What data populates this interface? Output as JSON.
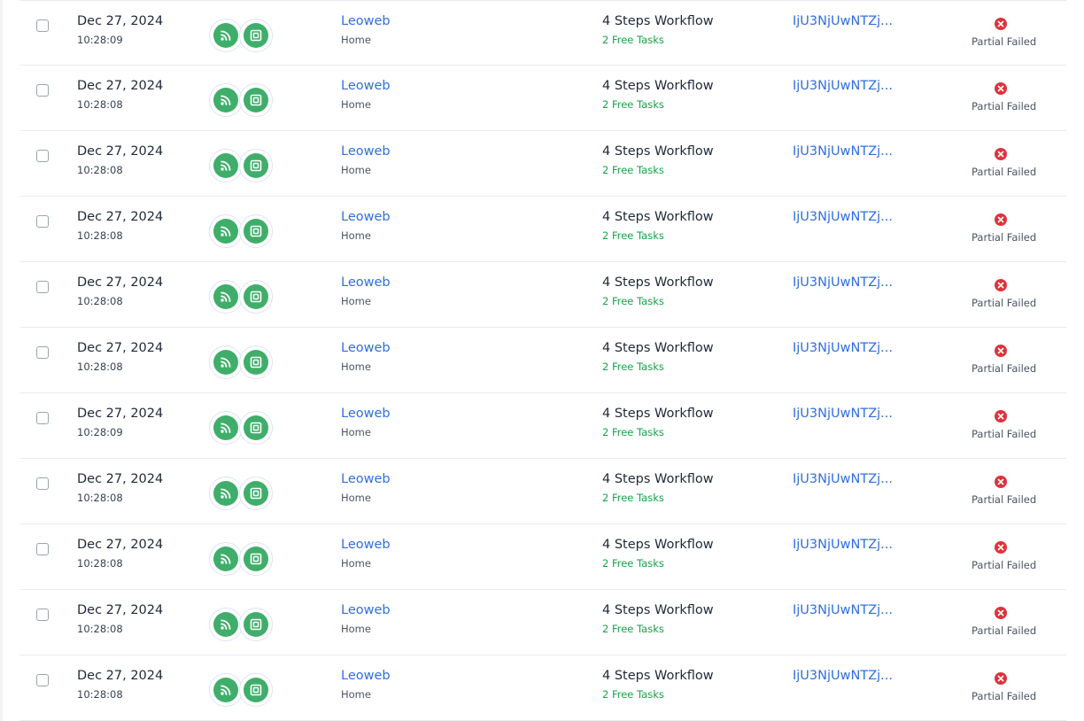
{
  "colors": {
    "link": "#2f6fe0",
    "app_green": "#3fae6a",
    "free_tasks_green": "#16a34a",
    "failed_red": "#e0323a"
  },
  "icons": {
    "app_1": "rss-feed-icon",
    "app_2": "scan-frame-icon",
    "status": "x-circle-icon"
  },
  "rows": [
    {
      "date": "Dec 27, 2024",
      "time": "10:28:09",
      "connection": "Leoweb",
      "connection_sub": "Home",
      "workflow": "4 Steps Workflow",
      "tasks": "2 Free Tasks",
      "task_id": "IjU3NjUwNTZj...",
      "status": "Partial Failed"
    },
    {
      "date": "Dec 27, 2024",
      "time": "10:28:08",
      "connection": "Leoweb",
      "connection_sub": "Home",
      "workflow": "4 Steps Workflow",
      "tasks": "2 Free Tasks",
      "task_id": "IjU3NjUwNTZj...",
      "status": "Partial Failed"
    },
    {
      "date": "Dec 27, 2024",
      "time": "10:28:08",
      "connection": "Leoweb",
      "connection_sub": "Home",
      "workflow": "4 Steps Workflow",
      "tasks": "2 Free Tasks",
      "task_id": "IjU3NjUwNTZj...",
      "status": "Partial Failed"
    },
    {
      "date": "Dec 27, 2024",
      "time": "10:28:08",
      "connection": "Leoweb",
      "connection_sub": "Home",
      "workflow": "4 Steps Workflow",
      "tasks": "2 Free Tasks",
      "task_id": "IjU3NjUwNTZj...",
      "status": "Partial Failed"
    },
    {
      "date": "Dec 27, 2024",
      "time": "10:28:08",
      "connection": "Leoweb",
      "connection_sub": "Home",
      "workflow": "4 Steps Workflow",
      "tasks": "2 Free Tasks",
      "task_id": "IjU3NjUwNTZj...",
      "status": "Partial Failed"
    },
    {
      "date": "Dec 27, 2024",
      "time": "10:28:08",
      "connection": "Leoweb",
      "connection_sub": "Home",
      "workflow": "4 Steps Workflow",
      "tasks": "2 Free Tasks",
      "task_id": "IjU3NjUwNTZj...",
      "status": "Partial Failed"
    },
    {
      "date": "Dec 27, 2024",
      "time": "10:28:09",
      "connection": "Leoweb",
      "connection_sub": "Home",
      "workflow": "4 Steps Workflow",
      "tasks": "2 Free Tasks",
      "task_id": "IjU3NjUwNTZj...",
      "status": "Partial Failed"
    },
    {
      "date": "Dec 27, 2024",
      "time": "10:28:08",
      "connection": "Leoweb",
      "connection_sub": "Home",
      "workflow": "4 Steps Workflow",
      "tasks": "2 Free Tasks",
      "task_id": "IjU3NjUwNTZj...",
      "status": "Partial Failed"
    },
    {
      "date": "Dec 27, 2024",
      "time": "10:28:08",
      "connection": "Leoweb",
      "connection_sub": "Home",
      "workflow": "4 Steps Workflow",
      "tasks": "2 Free Tasks",
      "task_id": "IjU3NjUwNTZj...",
      "status": "Partial Failed"
    },
    {
      "date": "Dec 27, 2024",
      "time": "10:28:08",
      "connection": "Leoweb",
      "connection_sub": "Home",
      "workflow": "4 Steps Workflow",
      "tasks": "2 Free Tasks",
      "task_id": "IjU3NjUwNTZj...",
      "status": "Partial Failed"
    },
    {
      "date": "Dec 27, 2024",
      "time": "10:28:08",
      "connection": "Leoweb",
      "connection_sub": "Home",
      "workflow": "4 Steps Workflow",
      "tasks": "2 Free Tasks",
      "task_id": "IjU3NjUwNTZj...",
      "status": "Partial Failed"
    }
  ]
}
